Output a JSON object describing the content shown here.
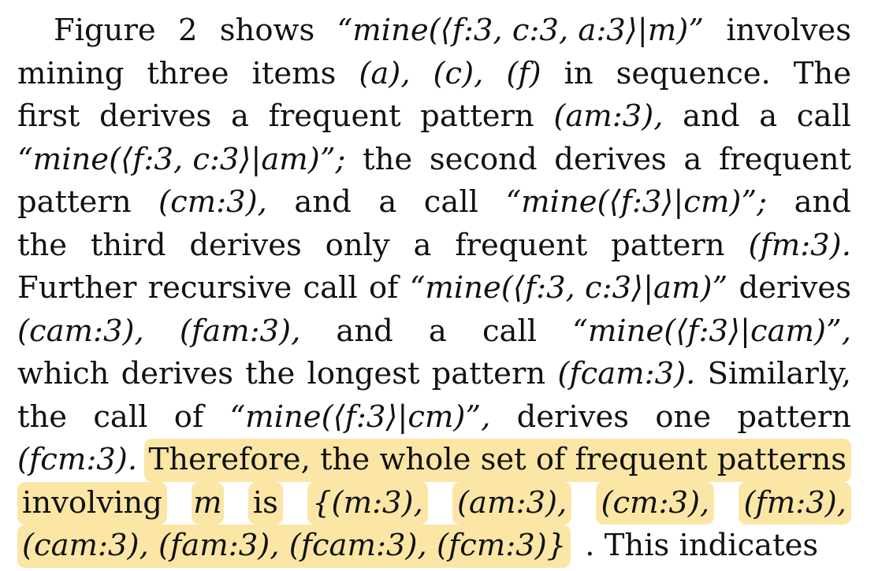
{
  "paragraph": {
    "lines": [
      [
        "Figure",
        "2",
        "shows",
        "“mine(⟨f:3, c:3, a:3⟩|m)”",
        "involves"
      ],
      [
        "mining",
        "three",
        "items",
        "(a),",
        "(c),",
        "(f)",
        "in",
        "sequence.",
        "The"
      ],
      [
        "first",
        "derives",
        "a",
        "frequent",
        "pattern",
        "(am:3),",
        "and",
        "a",
        "call"
      ],
      [
        "“mine(⟨f:3, c:3⟩|am)”;",
        "the",
        "second",
        "derives",
        "a",
        "frequent"
      ],
      [
        "pattern",
        "(cm:3),",
        "and",
        "a",
        "call",
        "“mine(⟨f:3⟩|cm)”;",
        "and"
      ],
      [
        "the",
        "third",
        "derives",
        "only",
        "a",
        "frequent",
        "pattern",
        "(fm:3)."
      ],
      [
        "Further",
        "recursive",
        "call",
        "of",
        "“mine(⟨f:3, c:3⟩|am)”",
        "derives"
      ],
      [
        "(cam:3),",
        "(fam:3),",
        "and",
        "a",
        "call",
        "“mine(⟨f:3⟩|cam)”,"
      ],
      [
        "which",
        "derives",
        "the",
        "longest",
        "pattern",
        "(fcam:3).",
        "Similarly,"
      ],
      [
        "the",
        "call",
        "of",
        "“mine(⟨f:3⟩|cm)”,",
        "derives",
        "one",
        "pattern"
      ],
      [
        "(fcm:3).",
        "Therefore, the whole set of frequent patterns"
      ],
      [
        "involving",
        "m",
        "is",
        "{(m:3),",
        "(am:3),",
        "(cm:3),",
        "(fm:3),"
      ],
      [
        "(cam:3), (fam:3), (fcam:3), (fcm:3)}",
        ". This indicates"
      ]
    ],
    "highlight_color": "#fbe6a6"
  }
}
